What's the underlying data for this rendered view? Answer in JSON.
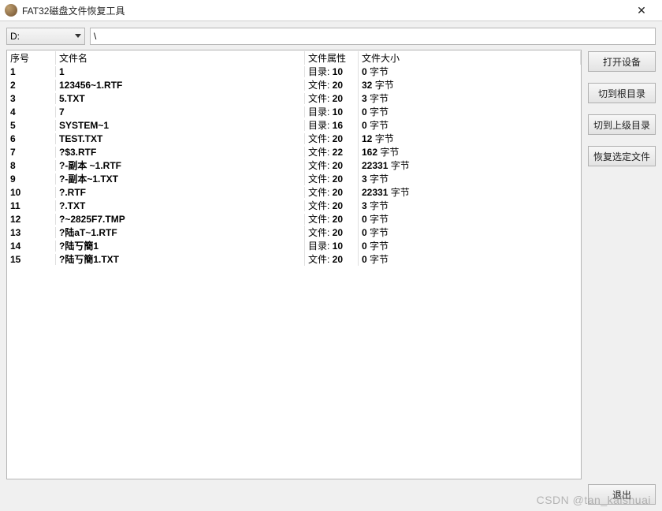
{
  "window": {
    "title": "FAT32磁盘文件恢复工具"
  },
  "drive": {
    "selected": "D:"
  },
  "path": {
    "value": "\\"
  },
  "columns": {
    "idx": "序号",
    "name": "文件名",
    "attr": "文件属性",
    "size": "文件大小"
  },
  "size_unit": "字节",
  "rows": [
    {
      "idx": "1",
      "name": "1",
      "attr_label": "目录",
      "attr_val": "10",
      "size": "0"
    },
    {
      "idx": "2",
      "name": "123456~1.RTF",
      "attr_label": "文件",
      "attr_val": "20",
      "size": "32"
    },
    {
      "idx": "3",
      "name": "5.TXT",
      "attr_label": "文件",
      "attr_val": "20",
      "size": "3"
    },
    {
      "idx": "4",
      "name": "7",
      "attr_label": "目录",
      "attr_val": "10",
      "size": "0"
    },
    {
      "idx": "5",
      "name": "SYSTEM~1",
      "attr_label": "目录",
      "attr_val": "16",
      "size": "0"
    },
    {
      "idx": "6",
      "name": "TEST.TXT",
      "attr_label": "文件",
      "attr_val": "20",
      "size": "12"
    },
    {
      "idx": "7",
      "name": "?$3.RTF",
      "attr_label": "文件",
      "attr_val": "22",
      "size": "162"
    },
    {
      "idx": "8",
      "name": "?-副本 ~1.RTF",
      "attr_label": "文件",
      "attr_val": "20",
      "size": "22331"
    },
    {
      "idx": "9",
      "name": "?-副本~1.TXT",
      "attr_label": "文件",
      "attr_val": "20",
      "size": "3"
    },
    {
      "idx": "10",
      "name": "?.RTF",
      "attr_label": "文件",
      "attr_val": "20",
      "size": "22331"
    },
    {
      "idx": "11",
      "name": "?.TXT",
      "attr_label": "文件",
      "attr_val": "20",
      "size": "3"
    },
    {
      "idx": "12",
      "name": "?~2825F7.TMP",
      "attr_label": "文件",
      "attr_val": "20",
      "size": "0"
    },
    {
      "idx": "13",
      "name": "?陆aT~1.RTF",
      "attr_label": "文件",
      "attr_val": "20",
      "size": "0"
    },
    {
      "idx": "14",
      "name": "?陆丂簡1",
      "attr_label": "目录",
      "attr_val": "10",
      "size": "0"
    },
    {
      "idx": "15",
      "name": "?陆丂簡1.TXT",
      "attr_label": "文件",
      "attr_val": "20",
      "size": "0"
    }
  ],
  "buttons": {
    "open": "打开设备",
    "goto_root": "切到根目录",
    "goto_parent": "切到上级目录",
    "recover": "恢复选定文件",
    "exit": "退出"
  },
  "watermark": "CSDN @tan_kaishuai"
}
